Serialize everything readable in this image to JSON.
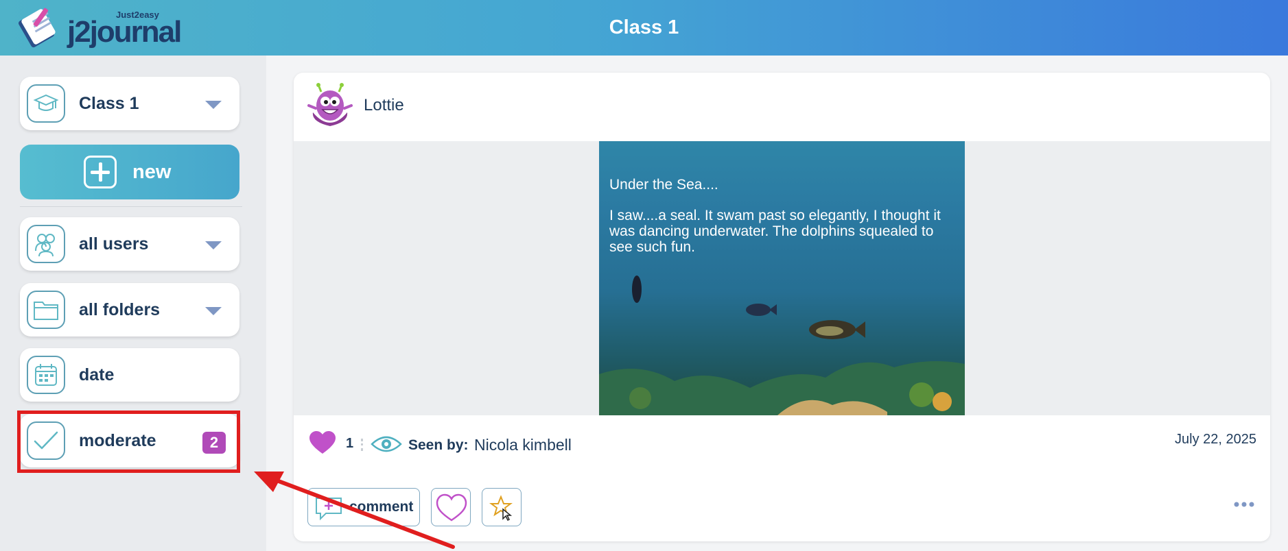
{
  "header": {
    "logo_text": "j2journal",
    "logo_subtext": "Just2easy",
    "title": "Class 1"
  },
  "sidebar": {
    "class_selector": {
      "label": "Class 1"
    },
    "new_button": {
      "label": "new"
    },
    "items": [
      {
        "label": "all users"
      },
      {
        "label": "all folders"
      },
      {
        "label": "date"
      },
      {
        "label": "moderate",
        "badge": "2"
      }
    ]
  },
  "post": {
    "author": "Lottie",
    "image_text": {
      "title": "Under the Sea....",
      "body": "I saw....a seal. It swam past so elegantly, I thought it was dancing underwater. The dolphins squealed to see such fun."
    },
    "like_count": "1",
    "seen_by_label": "Seen by:",
    "seen_by_name": "Nicola kimbell",
    "date": "July 22, 2025",
    "actions": {
      "comment_label": "comment"
    }
  },
  "colors": {
    "header_start": "#4fb3c9",
    "header_end": "#3a79dc",
    "accent_teal": "#56bdd0",
    "badge_purple": "#b04ab8",
    "heart_purple": "#c051c9",
    "highlight_red": "#e01e1e"
  }
}
